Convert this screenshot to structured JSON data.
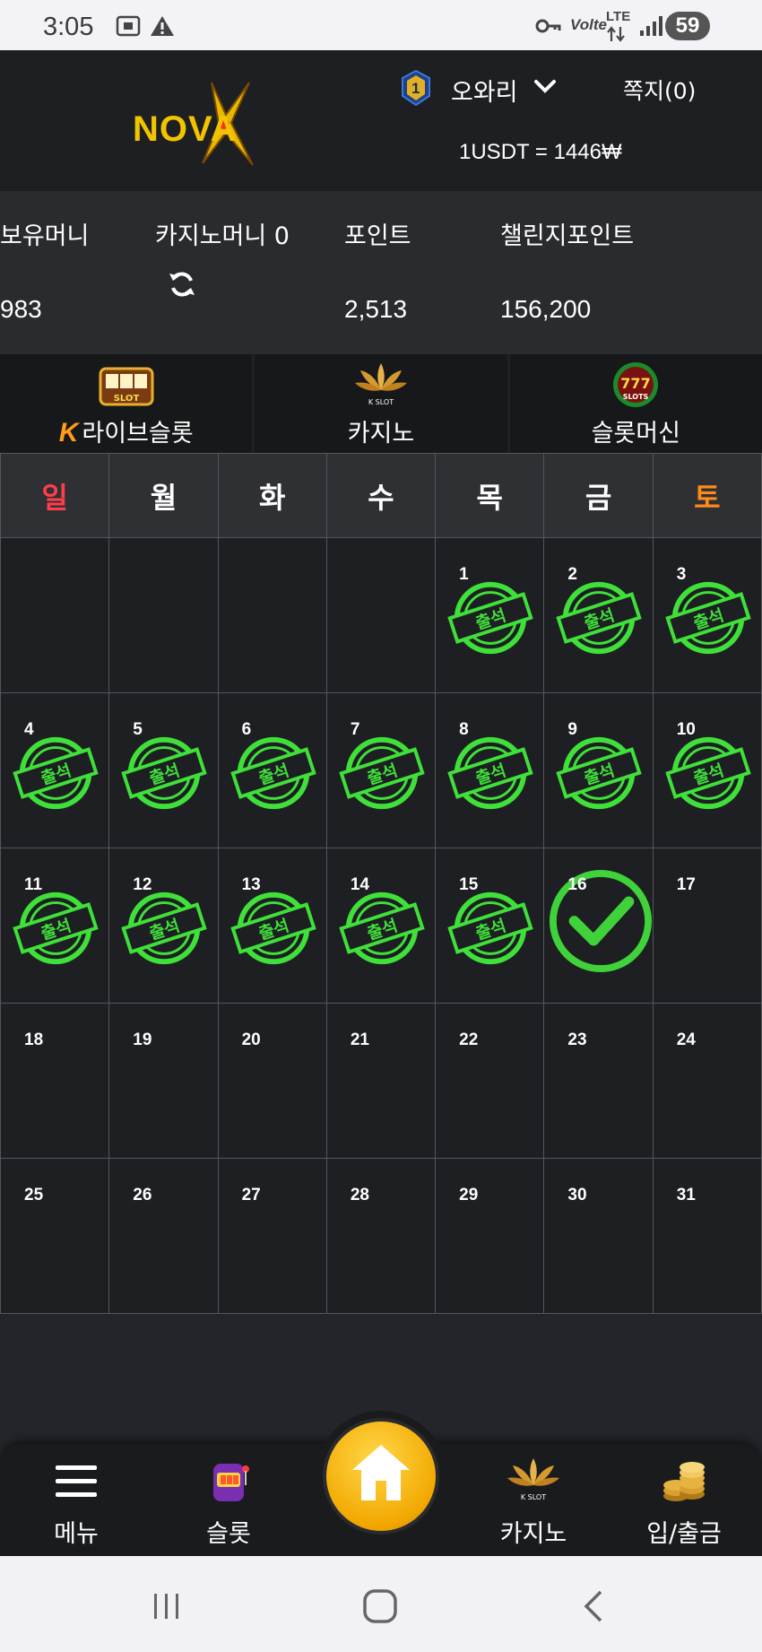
{
  "status_bar": {
    "time": "3:05",
    "network": "LTE",
    "volte": "Volte",
    "battery": "59"
  },
  "header": {
    "logo_text": "NOVA",
    "level": "1",
    "user_name": "오와리",
    "memo": "쪽지(0)",
    "exchange_rate": "1USDT = 1446₩"
  },
  "balances": {
    "cash_label": "보유머니",
    "cash_value": "983",
    "casino_label": "카지노머니 0",
    "point_label": "포인트",
    "point_value": "2,513",
    "challenge_label": "챌린지포인트",
    "challenge_value": "156,200"
  },
  "game_tabs": [
    {
      "label": "라이브슬롯",
      "icon": "live-slot-icon",
      "prefix": "K"
    },
    {
      "label": "카지노",
      "icon": "k-slot-lotus-icon"
    },
    {
      "label": "슬롯머신",
      "icon": "777-slots-icon"
    }
  ],
  "calendar": {
    "weekdays": [
      "일",
      "월",
      "화",
      "수",
      "목",
      "금",
      "토"
    ],
    "stamp_text": "출석",
    "weeks": [
      [
        {
          "d": ""
        },
        {
          "d": ""
        },
        {
          "d": ""
        },
        {
          "d": ""
        },
        {
          "d": "1",
          "s": "stamp"
        },
        {
          "d": "2",
          "s": "stamp"
        },
        {
          "d": "3",
          "s": "stamp"
        }
      ],
      [
        {
          "d": "4",
          "s": "stamp"
        },
        {
          "d": "5",
          "s": "stamp"
        },
        {
          "d": "6",
          "s": "stamp"
        },
        {
          "d": "7",
          "s": "stamp"
        },
        {
          "d": "8",
          "s": "stamp"
        },
        {
          "d": "9",
          "s": "stamp"
        },
        {
          "d": "10",
          "s": "stamp"
        }
      ],
      [
        {
          "d": "11",
          "s": "stamp"
        },
        {
          "d": "12",
          "s": "stamp"
        },
        {
          "d": "13",
          "s": "stamp"
        },
        {
          "d": "14",
          "s": "stamp"
        },
        {
          "d": "15",
          "s": "stamp"
        },
        {
          "d": "16",
          "s": "check"
        },
        {
          "d": "17"
        }
      ],
      [
        {
          "d": "18"
        },
        {
          "d": "19"
        },
        {
          "d": "20"
        },
        {
          "d": "21"
        },
        {
          "d": "22"
        },
        {
          "d": "23"
        },
        {
          "d": "24"
        }
      ],
      [
        {
          "d": "25"
        },
        {
          "d": "26"
        },
        {
          "d": "27"
        },
        {
          "d": "28"
        },
        {
          "d": "29"
        },
        {
          "d": "30"
        },
        {
          "d": "31"
        }
      ]
    ]
  },
  "bottom_nav": {
    "menu": "메뉴",
    "slot": "슬롯",
    "casino": "카지노",
    "deposit": "입/출금"
  },
  "colors": {
    "stamp_green": "#3fe03a",
    "gold": "#f2c300",
    "sunday": "#ff3e4a",
    "saturday": "#ff8a1a"
  }
}
